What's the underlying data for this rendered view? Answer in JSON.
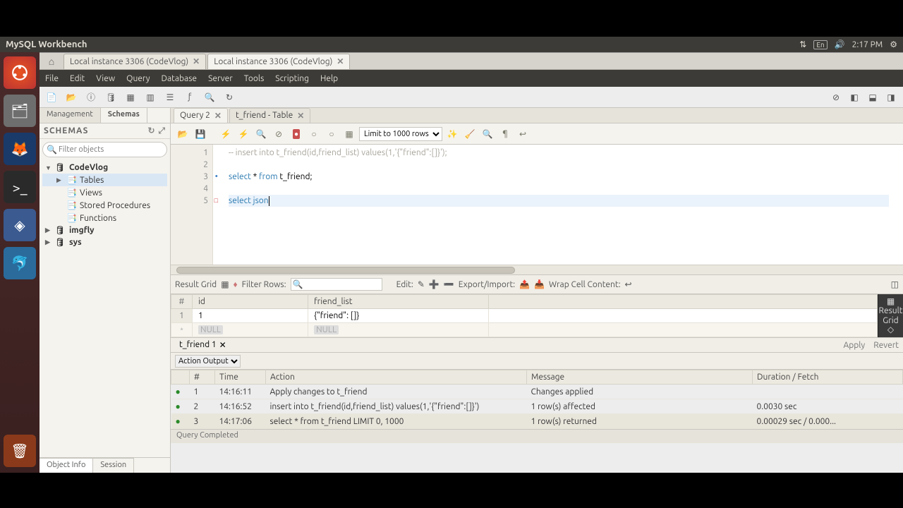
{
  "topbar": {
    "title": "MySQL Workbench",
    "lang": "En",
    "time": "2:17 PM"
  },
  "doc_tabs": [
    {
      "label": "Local instance 3306 (CodeVlog)",
      "active": false
    },
    {
      "label": "Local instance 3306 (CodeVlog)",
      "active": true
    }
  ],
  "menu": [
    "File",
    "Edit",
    "View",
    "Query",
    "Database",
    "Server",
    "Tools",
    "Scripting",
    "Help"
  ],
  "nav": {
    "tabs": [
      "Management",
      "Schemas"
    ],
    "schemas_label": "SCHEMAS",
    "filter_placeholder": "Filter objects",
    "tree": [
      {
        "label": "CodeVlog",
        "level": 0,
        "expanded": true
      },
      {
        "label": "Tables",
        "level": 1,
        "selected": true
      },
      {
        "label": "Views",
        "level": 1
      },
      {
        "label": "Stored Procedures",
        "level": 1
      },
      {
        "label": "Functions",
        "level": 1
      },
      {
        "label": "imgfly",
        "level": 0
      },
      {
        "label": "sys",
        "level": 0
      }
    ],
    "bottom_tabs": [
      "Object Info",
      "Session"
    ]
  },
  "editor": {
    "tabs": [
      {
        "label": "Query 2",
        "active": true
      },
      {
        "label": "t_friend - Table",
        "active": false
      }
    ],
    "limit": "Limit to 1000 rows",
    "lines": [
      {
        "n": 1,
        "comment": "-- insert into t_friend(id,friend_list) values(1,'{\"friend\":[]}');"
      },
      {
        "n": 2,
        "text": ""
      },
      {
        "n": 3,
        "kw": "select",
        "mid": " * ",
        "kw2": "from",
        "tail": " t_friend;",
        "dot": true
      },
      {
        "n": 4,
        "text": ""
      },
      {
        "n": 5,
        "kw": "select",
        "tail2": " json",
        "err": true,
        "current": true
      }
    ]
  },
  "grid": {
    "result_label": "Result Grid",
    "filter_label": "Filter Rows:",
    "edit_label": "Edit:",
    "export_label": "Export/Import:",
    "wrap_label": "Wrap Cell Content:",
    "side_label": "Result\nGrid",
    "columns": [
      "#",
      "id",
      "friend_list"
    ],
    "rows": [
      {
        "n": "1",
        "id": "1",
        "friend_list": "{\"friend\": []}"
      }
    ],
    "null_row": [
      "*",
      "NULL",
      "NULL"
    ],
    "res_tab": "t_friend 1",
    "apply": "Apply",
    "revert": "Revert"
  },
  "output": {
    "label": "Action Output",
    "columns": [
      "",
      "#",
      "Time",
      "Action",
      "Message",
      "Duration / Fetch"
    ],
    "rows": [
      {
        "ok": true,
        "n": "1",
        "time": "14:16:11",
        "action": "Apply changes to t_friend",
        "msg": "Changes applied",
        "dur": ""
      },
      {
        "ok": true,
        "n": "2",
        "time": "14:16:52",
        "action": "insert into t_friend(id,friend_list) values(1,'{\"friend\":[]}')",
        "msg": "1 row(s) affected",
        "dur": "0.0030 sec"
      },
      {
        "ok": true,
        "n": "3",
        "time": "14:17:06",
        "action": "select * from t_friend LIMIT 0, 1000",
        "msg": "1 row(s) returned",
        "dur": "0.00029 sec / 0.000...",
        "sel": true
      }
    ]
  },
  "status": "Query Completed"
}
